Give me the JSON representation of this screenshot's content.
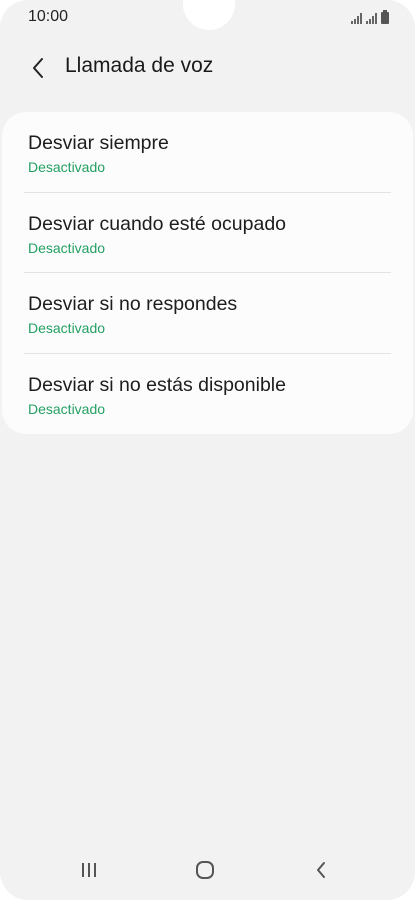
{
  "status_bar": {
    "time": "10:00"
  },
  "header": {
    "back_icon": "chevron-left-icon",
    "title": "Llamada de voz"
  },
  "list": {
    "items": [
      {
        "title": "Desviar siempre",
        "status": "Desactivado"
      },
      {
        "title": "Desviar cuando esté ocupado",
        "status": "Desactivado"
      },
      {
        "title": "Desviar si no respondes",
        "status": "Desactivado"
      },
      {
        "title": "Desviar si no estás disponible",
        "status": "Desactivado"
      }
    ]
  },
  "nav_bar": {
    "recents_icon": "recents-icon",
    "home_icon": "home-icon",
    "back_icon": "back-icon"
  },
  "colors": {
    "background": "#f2f2f2",
    "card": "#fcfcfc",
    "status_green": "#24a063",
    "text_primary": "#1d1d1d"
  }
}
